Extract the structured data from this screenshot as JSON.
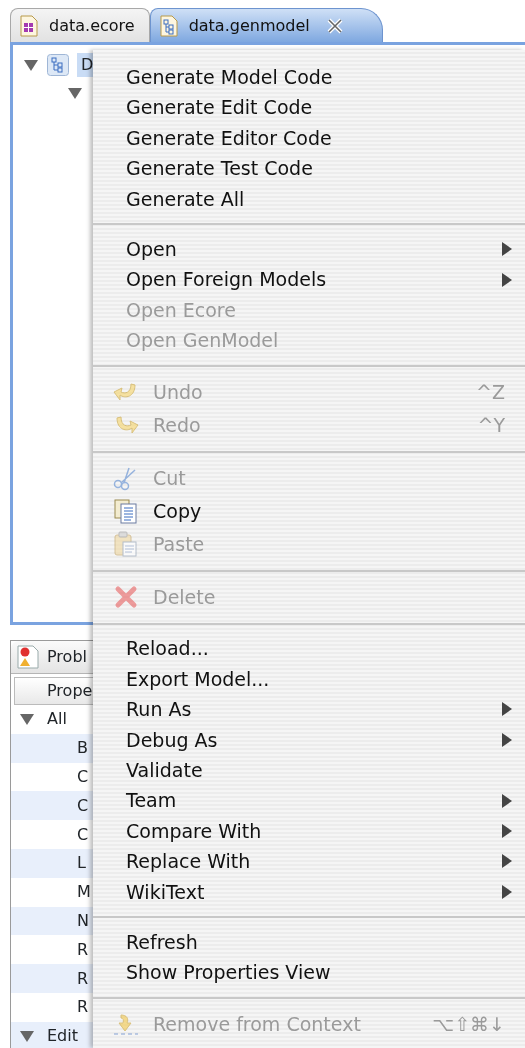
{
  "editor_tabs": [
    {
      "label": "data.ecore",
      "kind": "ecore",
      "selected": false,
      "closable": false
    },
    {
      "label": "data.genmodel",
      "kind": "genmodel",
      "selected": true,
      "closable": true
    }
  ],
  "tree": [
    {
      "label": "D",
      "selected": true,
      "expanded": true,
      "children": [
        {
          "expanded": true
        }
      ]
    }
  ],
  "bottom_panel": {
    "tab": "Probl",
    "column": "Prope",
    "groups": [
      {
        "label": "All",
        "expanded": true,
        "rows": [
          "B",
          "C",
          "C",
          "C",
          "L",
          "M",
          "N",
          "R",
          "R",
          "R"
        ]
      },
      {
        "label": "Edit",
        "expanded": true
      }
    ]
  },
  "context_menu": {
    "groups": [
      [
        {
          "label": "Generate Model Code",
          "kind": "plain",
          "disabled": false,
          "submenu": false
        },
        {
          "label": "Generate Edit Code",
          "kind": "plain",
          "disabled": false,
          "submenu": false
        },
        {
          "label": "Generate Editor Code",
          "kind": "plain",
          "disabled": false,
          "submenu": false
        },
        {
          "label": "Generate Test Code",
          "kind": "plain",
          "disabled": false,
          "submenu": false
        },
        {
          "label": "Generate All",
          "kind": "plain",
          "disabled": false,
          "submenu": false
        }
      ],
      [
        {
          "label": "Open",
          "kind": "plain",
          "disabled": false,
          "submenu": true
        },
        {
          "label": "Open Foreign Models",
          "kind": "plain",
          "disabled": false,
          "submenu": true
        },
        {
          "label": "Open Ecore",
          "kind": "plain",
          "disabled": true,
          "submenu": false
        },
        {
          "label": "Open GenModel",
          "kind": "plain",
          "disabled": true,
          "submenu": false
        }
      ],
      [
        {
          "label": "Undo",
          "kind": "undo",
          "disabled": true,
          "submenu": false,
          "shortcut": "^Z"
        },
        {
          "label": "Redo",
          "kind": "redo",
          "disabled": true,
          "submenu": false,
          "shortcut": "^Y"
        }
      ],
      [
        {
          "label": "Cut",
          "kind": "cut",
          "disabled": true,
          "submenu": false
        },
        {
          "label": "Copy",
          "kind": "copy",
          "disabled": false,
          "submenu": false
        },
        {
          "label": "Paste",
          "kind": "paste",
          "disabled": true,
          "submenu": false
        }
      ],
      [
        {
          "label": "Delete",
          "kind": "delete",
          "disabled": true,
          "submenu": false
        }
      ],
      [
        {
          "label": "Reload...",
          "kind": "plain",
          "disabled": false,
          "submenu": false
        },
        {
          "label": "Export Model...",
          "kind": "plain",
          "disabled": false,
          "submenu": false
        },
        {
          "label": "Run As",
          "kind": "plain",
          "disabled": false,
          "submenu": true
        },
        {
          "label": "Debug As",
          "kind": "plain",
          "disabled": false,
          "submenu": true
        },
        {
          "label": "Validate",
          "kind": "plain",
          "disabled": false,
          "submenu": false
        },
        {
          "label": "Team",
          "kind": "plain",
          "disabled": false,
          "submenu": true
        },
        {
          "label": "Compare With",
          "kind": "plain",
          "disabled": false,
          "submenu": true
        },
        {
          "label": "Replace With",
          "kind": "plain",
          "disabled": false,
          "submenu": true
        },
        {
          "label": "WikiText",
          "kind": "plain",
          "disabled": false,
          "submenu": true
        }
      ],
      [
        {
          "label": "Refresh",
          "kind": "plain",
          "disabled": false,
          "submenu": false
        },
        {
          "label": "Show Properties View",
          "kind": "plain",
          "disabled": false,
          "submenu": false
        }
      ],
      [
        {
          "label": "Remove from Context",
          "kind": "context",
          "disabled": true,
          "submenu": false,
          "shortcut": "⌥⇧⌘↓"
        }
      ]
    ]
  }
}
